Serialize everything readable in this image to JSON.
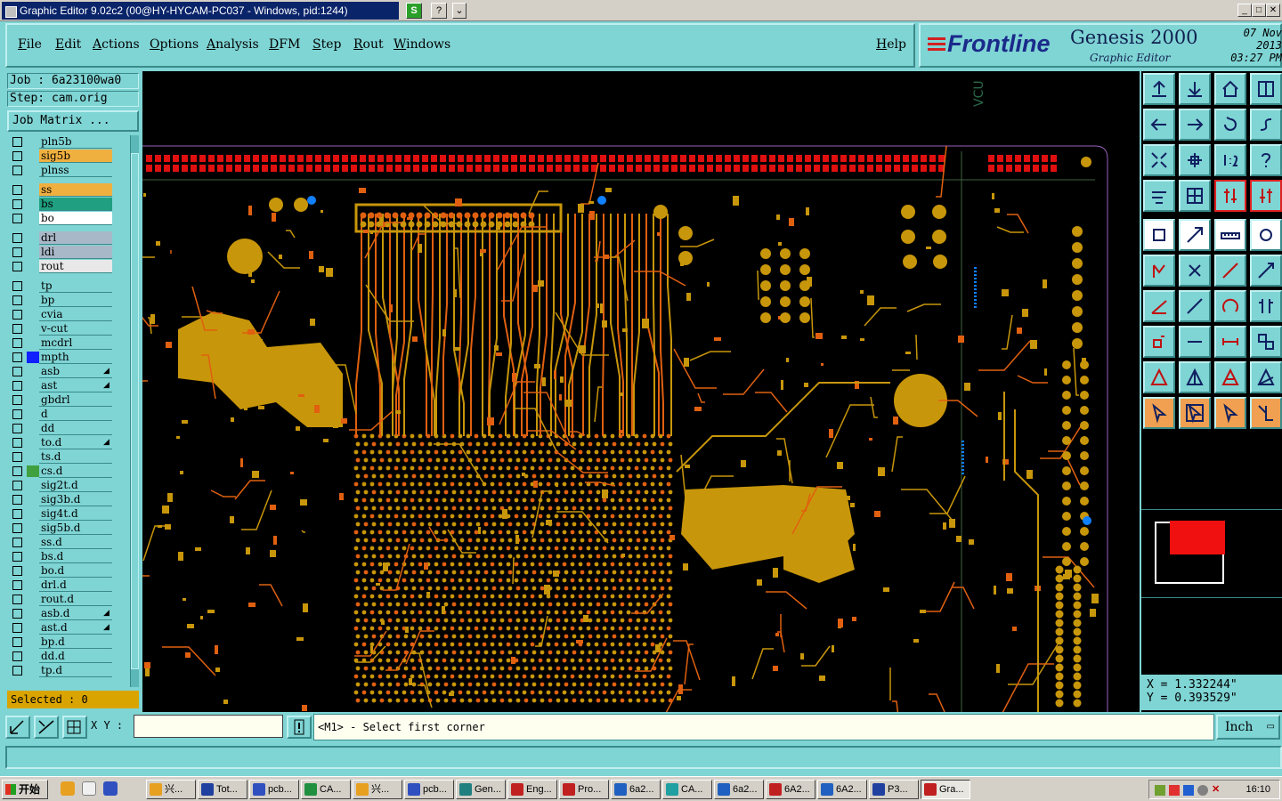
{
  "window": {
    "title": "Graphic Editor 9.02c2 (00@HY-HYCAM-PC037 - Windows, pid:1244)",
    "btn_s": "S",
    "btn_help": "?",
    "btn_arrow": "⌄",
    "ctrl_min": "_",
    "ctrl_max": "□",
    "ctrl_close": "✕"
  },
  "menubar": {
    "items": [
      "File",
      "Edit",
      "Actions",
      "Options",
      "Analysis",
      "DFM",
      "Step",
      "Rout",
      "Windows"
    ],
    "help": "Help"
  },
  "brand": {
    "logo": "Frontline",
    "product": "Genesis 2000",
    "subtitle": "Graphic Editor",
    "date": "07 Nov 2013",
    "time": "03:27 PM"
  },
  "job": {
    "job_label": "Job : 6a23100wa0",
    "step_label": "Step: cam.orig",
    "matrix_button": "Job Matrix ..."
  },
  "layers": [
    {
      "name": "pln5b",
      "color": "#7fd4d4"
    },
    {
      "name": "sig5b",
      "color": "#f0b040"
    },
    {
      "name": "plnss",
      "color": "#7fd4d4"
    },
    {
      "name": "ss",
      "color": "#f0b040"
    },
    {
      "name": "bs",
      "color": "#20a080"
    },
    {
      "name": "bo",
      "color": "#ffffff"
    },
    {
      "name": "drl",
      "color": "#a8b8c8"
    },
    {
      "name": "ldi",
      "color": "#a8b8c8"
    },
    {
      "name": "rout",
      "color": "#e8e8e8"
    },
    {
      "name": "tp",
      "color": "#7fd4d4"
    },
    {
      "name": "bp",
      "color": "#7fd4d4"
    },
    {
      "name": "cvia",
      "color": "#7fd4d4"
    },
    {
      "name": "v-cut",
      "color": "#7fd4d4"
    },
    {
      "name": "mcdrl",
      "color": "#7fd4d4"
    },
    {
      "name": "mpth",
      "color": "#7fd4d4"
    },
    {
      "name": "asb",
      "color": "#7fd4d4"
    },
    {
      "name": "ast",
      "color": "#7fd4d4"
    },
    {
      "name": "gbdrl",
      "color": "#7fd4d4"
    },
    {
      "name": "d",
      "color": "#7fd4d4"
    },
    {
      "name": "dd",
      "color": "#7fd4d4"
    },
    {
      "name": "to.d",
      "color": "#7fd4d4"
    },
    {
      "name": "ts.d",
      "color": "#7fd4d4"
    },
    {
      "name": "cs.d",
      "color": "#7fd4d4"
    },
    {
      "name": "sig2t.d",
      "color": "#7fd4d4"
    },
    {
      "name": "sig3b.d",
      "color": "#7fd4d4"
    },
    {
      "name": "sig4t.d",
      "color": "#7fd4d4"
    },
    {
      "name": "sig5b.d",
      "color": "#7fd4d4"
    },
    {
      "name": "ss.d",
      "color": "#7fd4d4"
    },
    {
      "name": "bs.d",
      "color": "#7fd4d4"
    },
    {
      "name": "bo.d",
      "color": "#7fd4d4"
    },
    {
      "name": "drl.d",
      "color": "#7fd4d4"
    },
    {
      "name": "rout.d",
      "color": "#7fd4d4"
    },
    {
      "name": "asb.d",
      "color": "#7fd4d4"
    },
    {
      "name": "ast.d",
      "color": "#7fd4d4"
    },
    {
      "name": "bp.d",
      "color": "#7fd4d4"
    },
    {
      "name": "dd.d",
      "color": "#7fd4d4"
    },
    {
      "name": "tp.d",
      "color": "#7fd4d4"
    }
  ],
  "selected": "Selected : 0",
  "canvas": {
    "label": "VCU",
    "copper_color": "#c8960a",
    "trace_color": "#e06010",
    "pad_red": "#e01010",
    "via_blue": "#1080ff"
  },
  "coords": {
    "x": "X = 1.332244\"",
    "y": "Y = 0.393529\""
  },
  "cmdbar": {
    "xy_label": "X Y :",
    "xy_value": "",
    "prompt": "<M1> - Select first corner",
    "units": "Inch"
  },
  "taskbar": {
    "start": "开始",
    "tasks": [
      "兴...",
      "Tot...",
      "pcb...",
      "CA...",
      "兴...",
      "pcb...",
      "Gen...",
      "Eng...",
      "Pro...",
      "6a2...",
      "CA...",
      "6a2...",
      "6A2...",
      "6A2...",
      "P3...",
      "Gra..."
    ],
    "clock": "16:10"
  }
}
